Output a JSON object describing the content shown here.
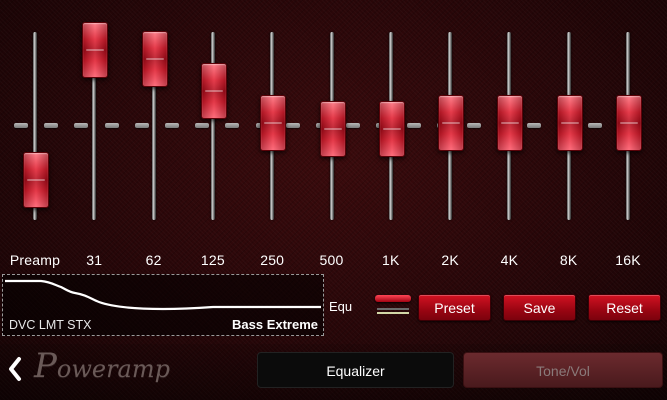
{
  "equalizer": {
    "bands": [
      {
        "label": "Preamp",
        "level": 0.22
      },
      {
        "label": "31",
        "level": 0.91
      },
      {
        "label": "62",
        "level": 0.86
      },
      {
        "label": "125",
        "level": 0.69
      },
      {
        "label": "250",
        "level": 0.52
      },
      {
        "label": "500",
        "level": 0.49
      },
      {
        "label": "1K",
        "level": 0.49
      },
      {
        "label": "2K",
        "level": 0.52
      },
      {
        "label": "4K",
        "level": 0.52
      },
      {
        "label": "8K",
        "level": 0.52
      },
      {
        "label": "16K",
        "level": 0.52
      }
    ]
  },
  "preset": {
    "left_text": "DVC LMT STX",
    "name": "Bass Extreme",
    "equ_label": "Equ"
  },
  "buttons": {
    "preset": "Preset",
    "save": "Save",
    "reset": "Reset"
  },
  "tabs": {
    "equalizer": "Equalizer",
    "tone": "Tone/Vol"
  },
  "brand": {
    "logo_initial": "P",
    "logo_rest": "oweramp"
  },
  "colors": {
    "accent": "#d21222",
    "background": "#260608",
    "knob": "#e21a2c"
  },
  "icons": {
    "back": "chevron-left-icon",
    "equ_toggle": "toggle-bars-icon"
  }
}
